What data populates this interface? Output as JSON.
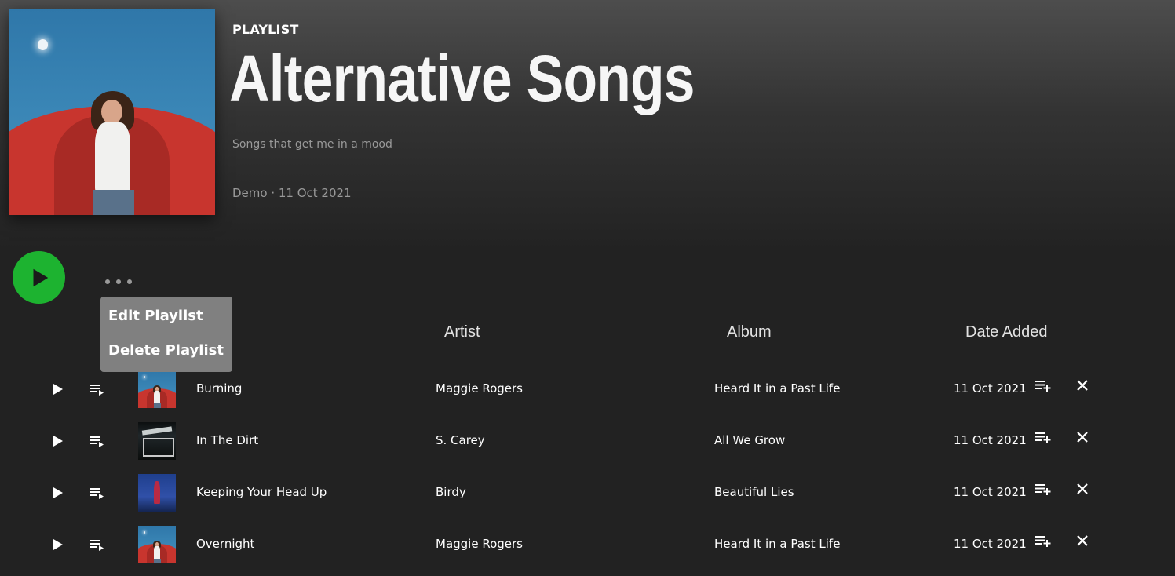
{
  "playlist": {
    "type_label": "PLAYLIST",
    "title": "Alternative Songs",
    "description": "Songs that get me in a mood",
    "meta": "Demo · 11 Oct 2021"
  },
  "menu": {
    "edit_label": "Edit Playlist",
    "delete_label": "Delete Playlist"
  },
  "table": {
    "headers": {
      "title_partial": "e",
      "artist": "Artist",
      "album": "Album",
      "date_added": "Date Added"
    },
    "rows": [
      {
        "title": "Burning",
        "artist": "Maggie Rogers",
        "album": "Heard It in a Past Life",
        "date": "11 Oct 2021"
      },
      {
        "title": "In The Dirt",
        "artist": "S. Carey",
        "album": "All We Grow",
        "date": "11 Oct 2021"
      },
      {
        "title": "Keeping Your Head Up",
        "artist": "Birdy",
        "album": "Beautiful Lies",
        "date": "11 Oct 2021"
      },
      {
        "title": "Overnight",
        "artist": "Maggie Rogers",
        "album": "Heard It in a Past Life",
        "date": "11 Oct 2021"
      }
    ]
  },
  "icons": {
    "play": "play-icon",
    "queue": "queue-music-icon",
    "add_to_playlist": "playlist-add-icon",
    "remove": "close-icon",
    "more": "more-horizontal-icon"
  },
  "colors": {
    "accent": "#1db330",
    "background": "#222222",
    "menu": "#808080"
  }
}
